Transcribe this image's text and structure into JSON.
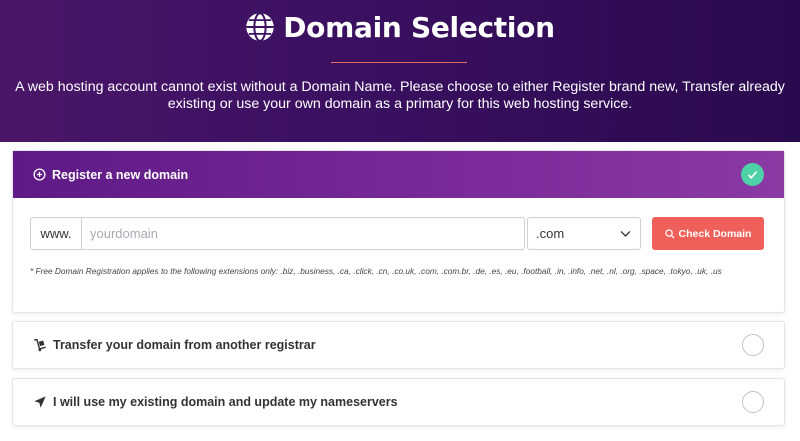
{
  "hero": {
    "title": "Domain Selection",
    "title_icon": "globe-icon",
    "description": "A web hosting account cannot exist without a Domain Name. Please choose to either Register brand new, Transfer already existing or use your own domain as a primary for this web hosting service."
  },
  "options": {
    "register": {
      "label": "Register a new domain",
      "icon": "plus-circle-icon",
      "selected": true,
      "prefix": "www.",
      "input_placeholder": "yourdomain",
      "input_value": "",
      "tld_selected": ".com",
      "check_button": "Check Domain",
      "note": "* Free Domain Registration applies to the following extensions only: .biz, .business, .ca, .click, .cn, .co.uk, .com, .com.br, .de, .es, .eu, .football, .in, .info, .net, .nl, .org, .space, .tokyo, .uk, .us"
    },
    "transfer": {
      "label": "Transfer your domain from another registrar",
      "icon": "hand-truck-icon",
      "selected": false
    },
    "existing": {
      "label": "I will use my existing domain and update my nameservers",
      "icon": "location-arrow-icon",
      "selected": false
    }
  },
  "colors": {
    "hero_start": "#4a1668",
    "hero_end": "#2a0a4e",
    "active_header": "#7b2b9a",
    "check_green": "#4fd1a8",
    "button_red": "#f0605a",
    "divider": "#e86a5f"
  }
}
